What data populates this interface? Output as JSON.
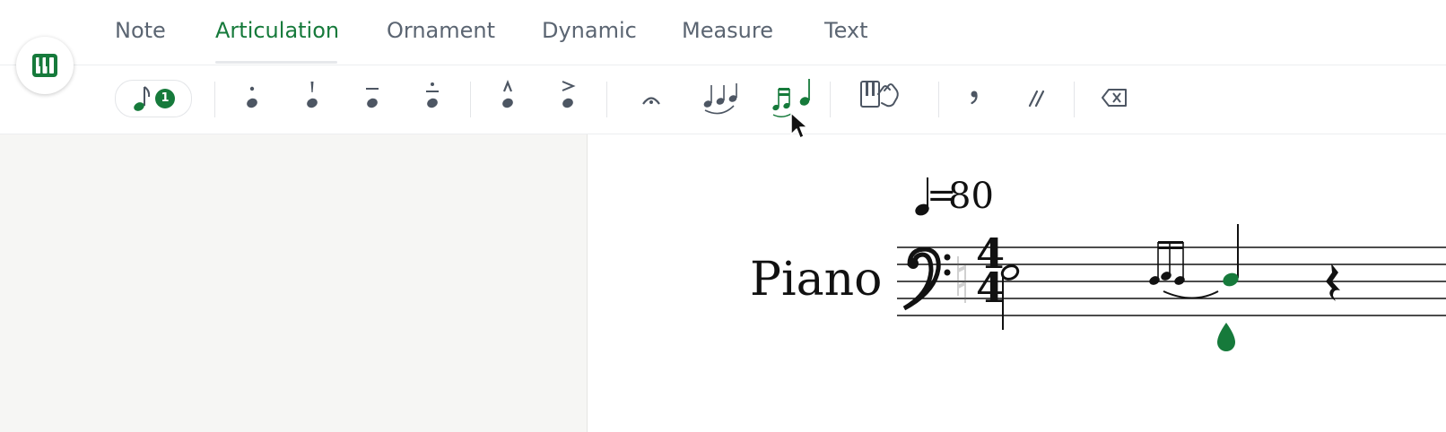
{
  "tabs": [
    {
      "label": "Note"
    },
    {
      "label": "Articulation",
      "active": true
    },
    {
      "label": "Ornament"
    },
    {
      "label": "Dynamic"
    },
    {
      "label": "Measure"
    },
    {
      "label": "Text"
    }
  ],
  "toolbar": {
    "selection_count": "1",
    "tools": [
      "staccato-icon",
      "staccatissimo-icon",
      "tenuto-icon",
      "portato-icon",
      "marcato-icon",
      "accent-icon",
      "fermata-icon",
      "slur-icon",
      "grace-notes-icon",
      "gesture-icon",
      "breath-mark-icon",
      "caesura-icon",
      "delete-icon"
    ]
  },
  "score": {
    "tempo_value": "80",
    "tempo_eq": "=",
    "instrument": "Piano",
    "time_signature": {
      "top": "4",
      "bottom": "4"
    }
  },
  "colors": {
    "accent": "#167a3b",
    "tab_text": "#5b6572",
    "icon": "#4d5663"
  }
}
